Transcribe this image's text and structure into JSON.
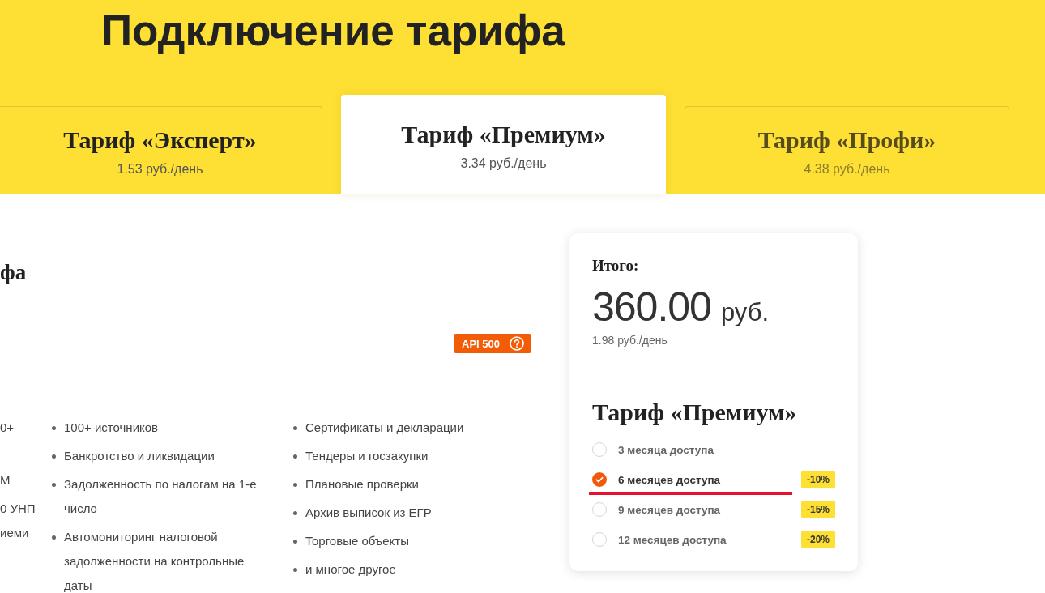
{
  "header": {
    "title": "Подключение тарифа"
  },
  "tariff_tabs": [
    {
      "name": "Тариф «Эксперт»",
      "price": "1.53 руб./день",
      "selected": false,
      "dimmed": false
    },
    {
      "name": "Тариф «Премиум»",
      "price": "3.34 руб./день",
      "selected": true,
      "dimmed": false
    },
    {
      "name": "Тариф «Профи»",
      "price": "4.38 руб./день",
      "selected": false,
      "dimmed": true
    }
  ],
  "features": {
    "heading": "фа",
    "badge": {
      "label": "API 500"
    },
    "column_1": [
      [
        "0+"
      ],
      [
        "М"
      ],
      [
        "0 УНП",
        "иеми"
      ]
    ],
    "column_2": [
      "100+ источников",
      "Банкротство и ликвидации",
      "Задолженность по налогам на 1-е число",
      "Автомониторинг налоговой задолженности на контрольные даты"
    ],
    "column_3": [
      "Сертификаты и декларации",
      "Тендеры и госзакупки",
      "Плановые проверки",
      "Архив выписок из ЕГР",
      "Торговые объекты",
      "и многое другое"
    ]
  },
  "summary": {
    "label": "Итого:",
    "amount": "360.00",
    "currency": "руб.",
    "per_day": "1.98 руб./день",
    "tariff": "Тариф «Премиум»",
    "options": [
      {
        "label": "3 месяца доступа",
        "selected": false,
        "underlined": false
      },
      {
        "label": "6 месяцев доступа",
        "selected": true,
        "underlined": true,
        "discount": "-10%"
      },
      {
        "label": "9 месяцев доступа",
        "selected": false,
        "underlined": false,
        "discount": "-15%"
      },
      {
        "label": "12 месяцев доступа",
        "selected": false,
        "underlined": false,
        "discount": "-20%"
      }
    ]
  }
}
